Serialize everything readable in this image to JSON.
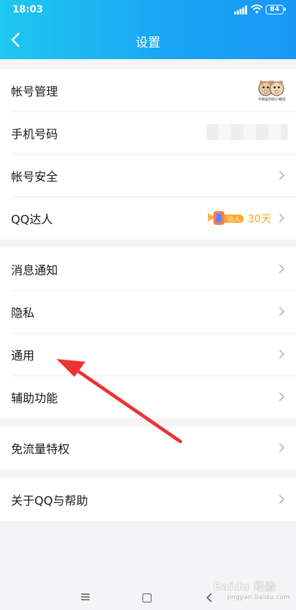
{
  "status_bar": {
    "time": "18:03",
    "battery": "84"
  },
  "header": {
    "title": "设置"
  },
  "sections": [
    {
      "items": [
        {
          "label": "帐号管理"
        },
        {
          "label": "手机号码"
        },
        {
          "label": "帐号安全"
        },
        {
          "label": "QQ达人"
        }
      ]
    },
    {
      "items": [
        {
          "label": "消息通知"
        },
        {
          "label": "隐私"
        },
        {
          "label": "通用"
        },
        {
          "label": "辅助功能"
        }
      ]
    },
    {
      "items": [
        {
          "label": "免流量特权"
        }
      ]
    },
    {
      "items": [
        {
          "label": "关于QQ与帮助"
        }
      ]
    }
  ],
  "account": {
    "avatar_caption": "与我是你的小萌宝"
  },
  "vip": {
    "badge_text": "达人",
    "days": "30天"
  },
  "watermark": {
    "text": "Baidu 经验",
    "sub": "jingyan.baidu.com"
  },
  "colors": {
    "header_start": "#1ec8ee",
    "header_end": "#1798f6",
    "accent_orange": "#f5a623",
    "annotation_red": "#ee3333"
  }
}
